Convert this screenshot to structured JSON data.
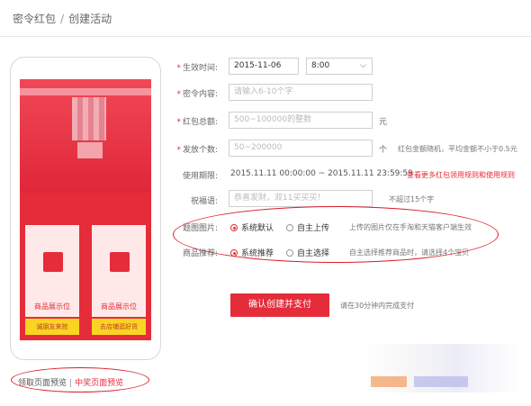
{
  "breadcrumb": {
    "parent": "密令红包",
    "current": "创建活动"
  },
  "phone": {
    "card_left": "商品展示位",
    "card_right": "商品展示位",
    "btn_left": "诚朋友来抢",
    "btn_right": "去店铺逛好货"
  },
  "preview_links": {
    "pickup": "领取页面预览",
    "winner": "中奖页面预览"
  },
  "form": {
    "start_time": {
      "label": "生效时间:",
      "date": "2015-11-06",
      "time": "8:00"
    },
    "secret": {
      "label": "密令内容:",
      "placeholder": "请输入6-10个字"
    },
    "total": {
      "label": "红包总额:",
      "placeholder": "500~100000的整数",
      "unit": "元"
    },
    "count": {
      "label": "发放个数:",
      "placeholder": "50~200000",
      "unit": "个",
      "note": "红包金额随机，平均金额不小于0.5元"
    },
    "period": {
      "label": "使用期限:",
      "value": "2015.11.11 00:00:00 ~ 2015.11.11 23:59:59",
      "link": "查看更多红包领用规则和使用规则"
    },
    "blessing": {
      "label": "祝福语:",
      "placeholder": "恭喜发财，双11买买买！",
      "note": "不超过15个字"
    },
    "banner": {
      "label": "题图图片:",
      "opt1": "系统默认",
      "opt2": "自主上传",
      "note": "上传的图片仅在手淘和天猫客户端生效"
    },
    "recommend": {
      "label": "商品推荐:",
      "opt1": "系统推荐",
      "opt2": "自主选择",
      "note": "自主选择推荐商品时，请选择4个宝贝"
    },
    "submit": {
      "label": "确认创建并支付",
      "note": "请在30分钟内完成支付"
    }
  },
  "colors": {
    "accent": "#e52c3a",
    "annotation": "#d81e2a"
  }
}
